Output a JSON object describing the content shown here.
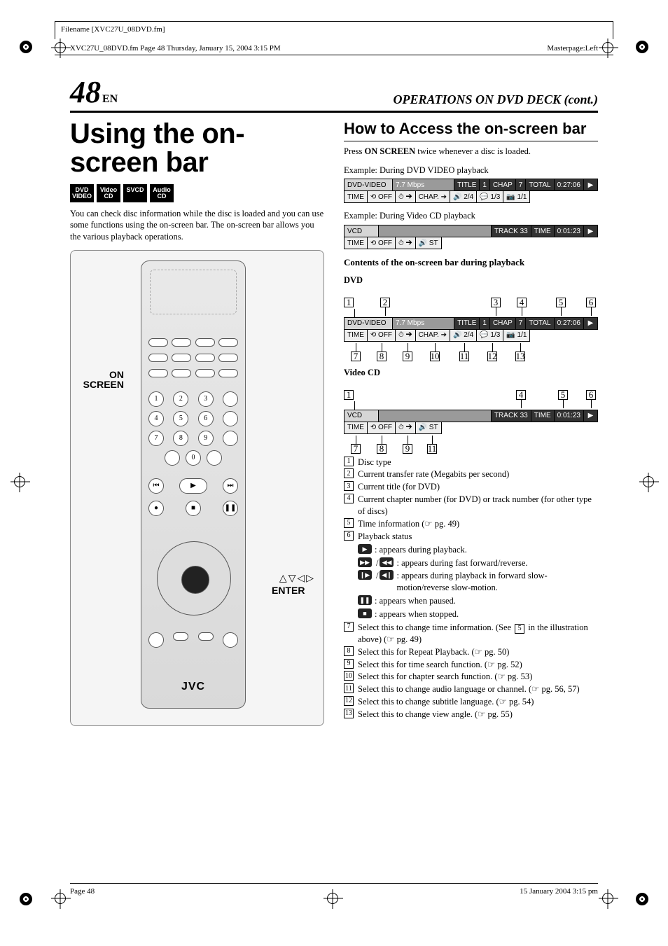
{
  "meta": {
    "filename_label": "Filename [XVC27U_08DVD.fm]",
    "frameline": "XVC27U_08DVD.fm  Page 48  Thursday, January 15, 2004  3:15 PM",
    "masterpage": "Masterpage:Left"
  },
  "header": {
    "page_number": "48",
    "page_lang": "EN",
    "section_title": "OPERATIONS ON DVD DECK (cont.)"
  },
  "left": {
    "title": "Using the on-screen bar",
    "badges": [
      "DVD VIDEO",
      "Video CD",
      "SVCD",
      "Audio CD"
    ],
    "intro": "You can check disc information while the disc is loaded and you can use some functions using the on-screen bar. The on-screen bar allows you the various playback operations.",
    "remote_labels": {
      "on_screen": "ON SCREEN",
      "enter": "ENTER",
      "arrows": "△▽◁▷",
      "brand": "JVC"
    }
  },
  "right": {
    "h2": "How to Access the on-screen bar",
    "press_line_pre": "Press ",
    "press_bold": "ON SCREEN",
    "press_line_post": " twice whenever a disc is loaded.",
    "ex1_label": "Example: During DVD VIDEO playback",
    "ex2_label": "Example: During Video CD playback",
    "contents_heading": "Contents of the on-screen bar during playback",
    "dvd_label": "DVD",
    "vcd_label": "Video CD",
    "dvd_bar": {
      "row1": [
        "DVD-VIDEO",
        "7.7 Mbps",
        "TITLE",
        "1",
        "CHAP",
        "7",
        "TOTAL",
        "0:27:06",
        "▶"
      ],
      "row2": [
        "TIME",
        "⟲ OFF",
        "⏱ ➔",
        "CHAP. ➔",
        "🔊 2/4",
        "💬 1/3",
        "📷 1/1"
      ]
    },
    "vcd_bar": {
      "row1": [
        "VCD",
        "",
        "TRACK 33",
        "TIME",
        "0:01:23",
        "▶"
      ],
      "row2": [
        "TIME",
        "⟲ OFF",
        "⏱ ➔",
        "🔊 ST"
      ]
    },
    "annot_dvd_top": [
      "1",
      "2",
      "3",
      "4",
      "5",
      "6"
    ],
    "annot_dvd_bot": [
      "7",
      "8",
      "9",
      "10",
      "11",
      "12",
      "13"
    ],
    "annot_vcd_top": [
      "1",
      "4",
      "5",
      "6"
    ],
    "annot_vcd_bot": [
      "7",
      "8",
      "9",
      "11"
    ],
    "legend": {
      "1": "Disc type",
      "2": "Current transfer rate (Megabits per second)",
      "3": "Current title (for DVD)",
      "4": "Current chapter number (for DVD) or track number (for other type of discs)",
      "5": "Time information (☞ pg. 49)",
      "6": "Playback status",
      "7a": "Select this to change time information. (See ",
      "7b": " in the illustration above) (☞ pg. 49)",
      "8": "Select this for Repeat Playback. (☞ pg. 50)",
      "9": "Select this for time search function. (☞ pg. 52)",
      "10": "Select this for chapter search function. (☞ pg. 53)",
      "11": "Select this to change audio language or channel. (☞ pg. 56, 57)",
      "12": "Select this to change subtitle language. (☞ pg. 54)",
      "13": "Select this to change view angle. (☞ pg. 55)"
    },
    "playback_status": {
      "play": ": appears during playback.",
      "ffrew": ": appears during fast forward/reverse.",
      "slow": ": appears during playback in forward slow-motion/reverse slow-motion.",
      "pause": ": appears when paused.",
      "stop": ": appears when stopped."
    }
  },
  "foot": {
    "left": "Page 48",
    "right": "15 January 2004 3:15 pm"
  }
}
